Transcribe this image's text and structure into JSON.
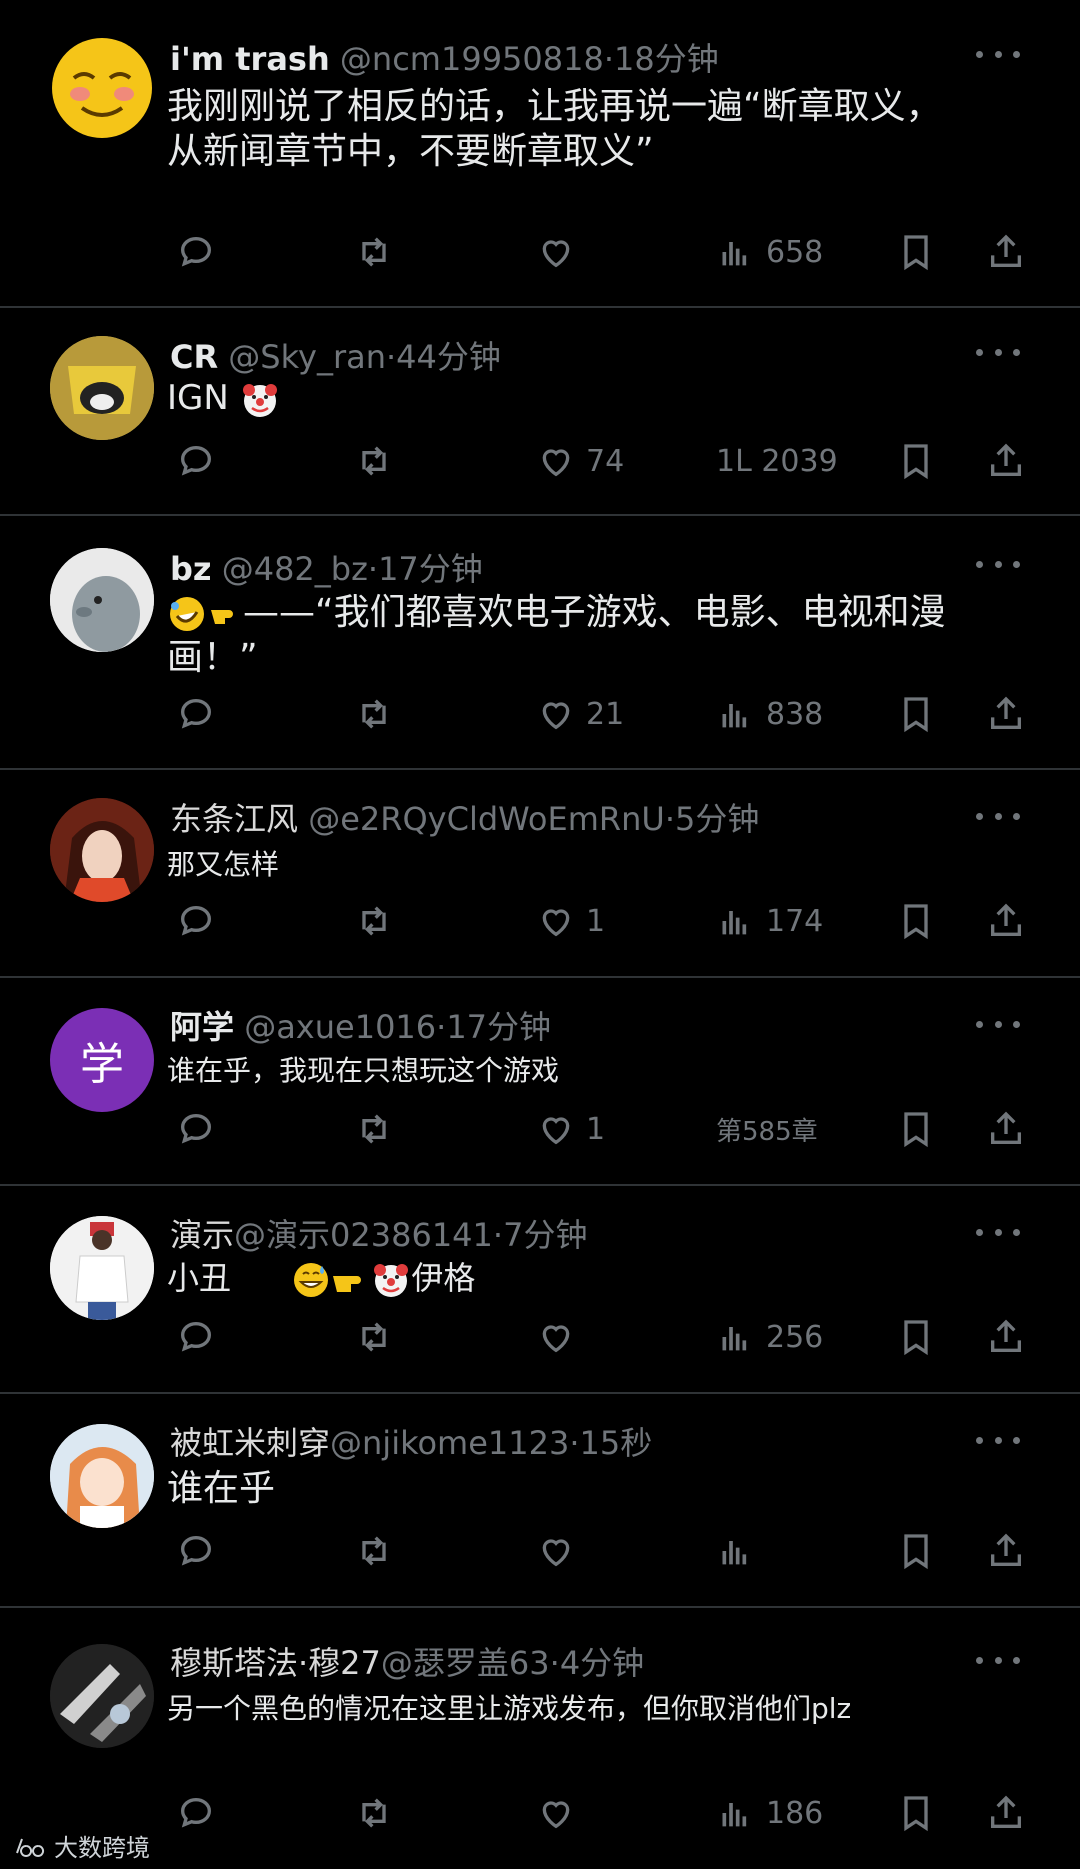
{
  "posts": [
    {
      "name": "i'm trash",
      "handle": "@ncm19950818",
      "time": "18分钟",
      "text_lines": [
        "我刚刚说了相反的话，让我再说一遍“断章取义，",
        "从新闻章节中，不要断章取义”"
      ],
      "likes": "",
      "views": "658"
    },
    {
      "name": "CR",
      "handle": "@Sky_ran",
      "time": "44分钟",
      "text_lines": [
        "IGN"
      ],
      "likes": "74",
      "views_text": "1L 2039"
    },
    {
      "name": "bz",
      "handle": "@482_bz",
      "time": "17分钟",
      "text_lines": [
        "——“我们都喜欢电子游戏、电影、电视和漫",
        "画！”"
      ],
      "likes": "21",
      "views": "838"
    },
    {
      "name": "东条江风",
      "handle": "@e2RQyCldWoEmRnU",
      "time": "5分钟",
      "text_lines": [
        "那又怎样"
      ],
      "likes": "1",
      "views": "174"
    },
    {
      "name": "阿学",
      "handle": "@axue1016",
      "time": "17分钟",
      "avatar_letter": "学",
      "text_lines": [
        "谁在乎，我现在只想玩这个游戏"
      ],
      "likes": "1",
      "views_text": "第585章"
    },
    {
      "name": "演示",
      "handle": "@演示02386141",
      "time": "7分钟",
      "text_lines": [
        "小丑",
        "伊格"
      ],
      "likes": "",
      "views": "256"
    },
    {
      "name": "被虹米刺穿",
      "handle": "@njikome1123",
      "time": "15秒",
      "text_lines": [
        "谁在乎"
      ],
      "likes": "",
      "views": ""
    },
    {
      "name": "穆斯塔法·穆27",
      "handle": "@瑟罗盖63",
      "time": "4分钟",
      "text_lines": [
        "另一个黑色的情况在这里让游戏发布，但你取消他们plz"
      ],
      "likes": "",
      "views": "186"
    }
  ],
  "sep": "·",
  "watermark": "大数跨境",
  "colors": {
    "background": "#000000",
    "text": "#e7e9ea",
    "muted": "#71767b",
    "divider": "#2f3336",
    "avatar_purple": "#7b2fb5"
  }
}
